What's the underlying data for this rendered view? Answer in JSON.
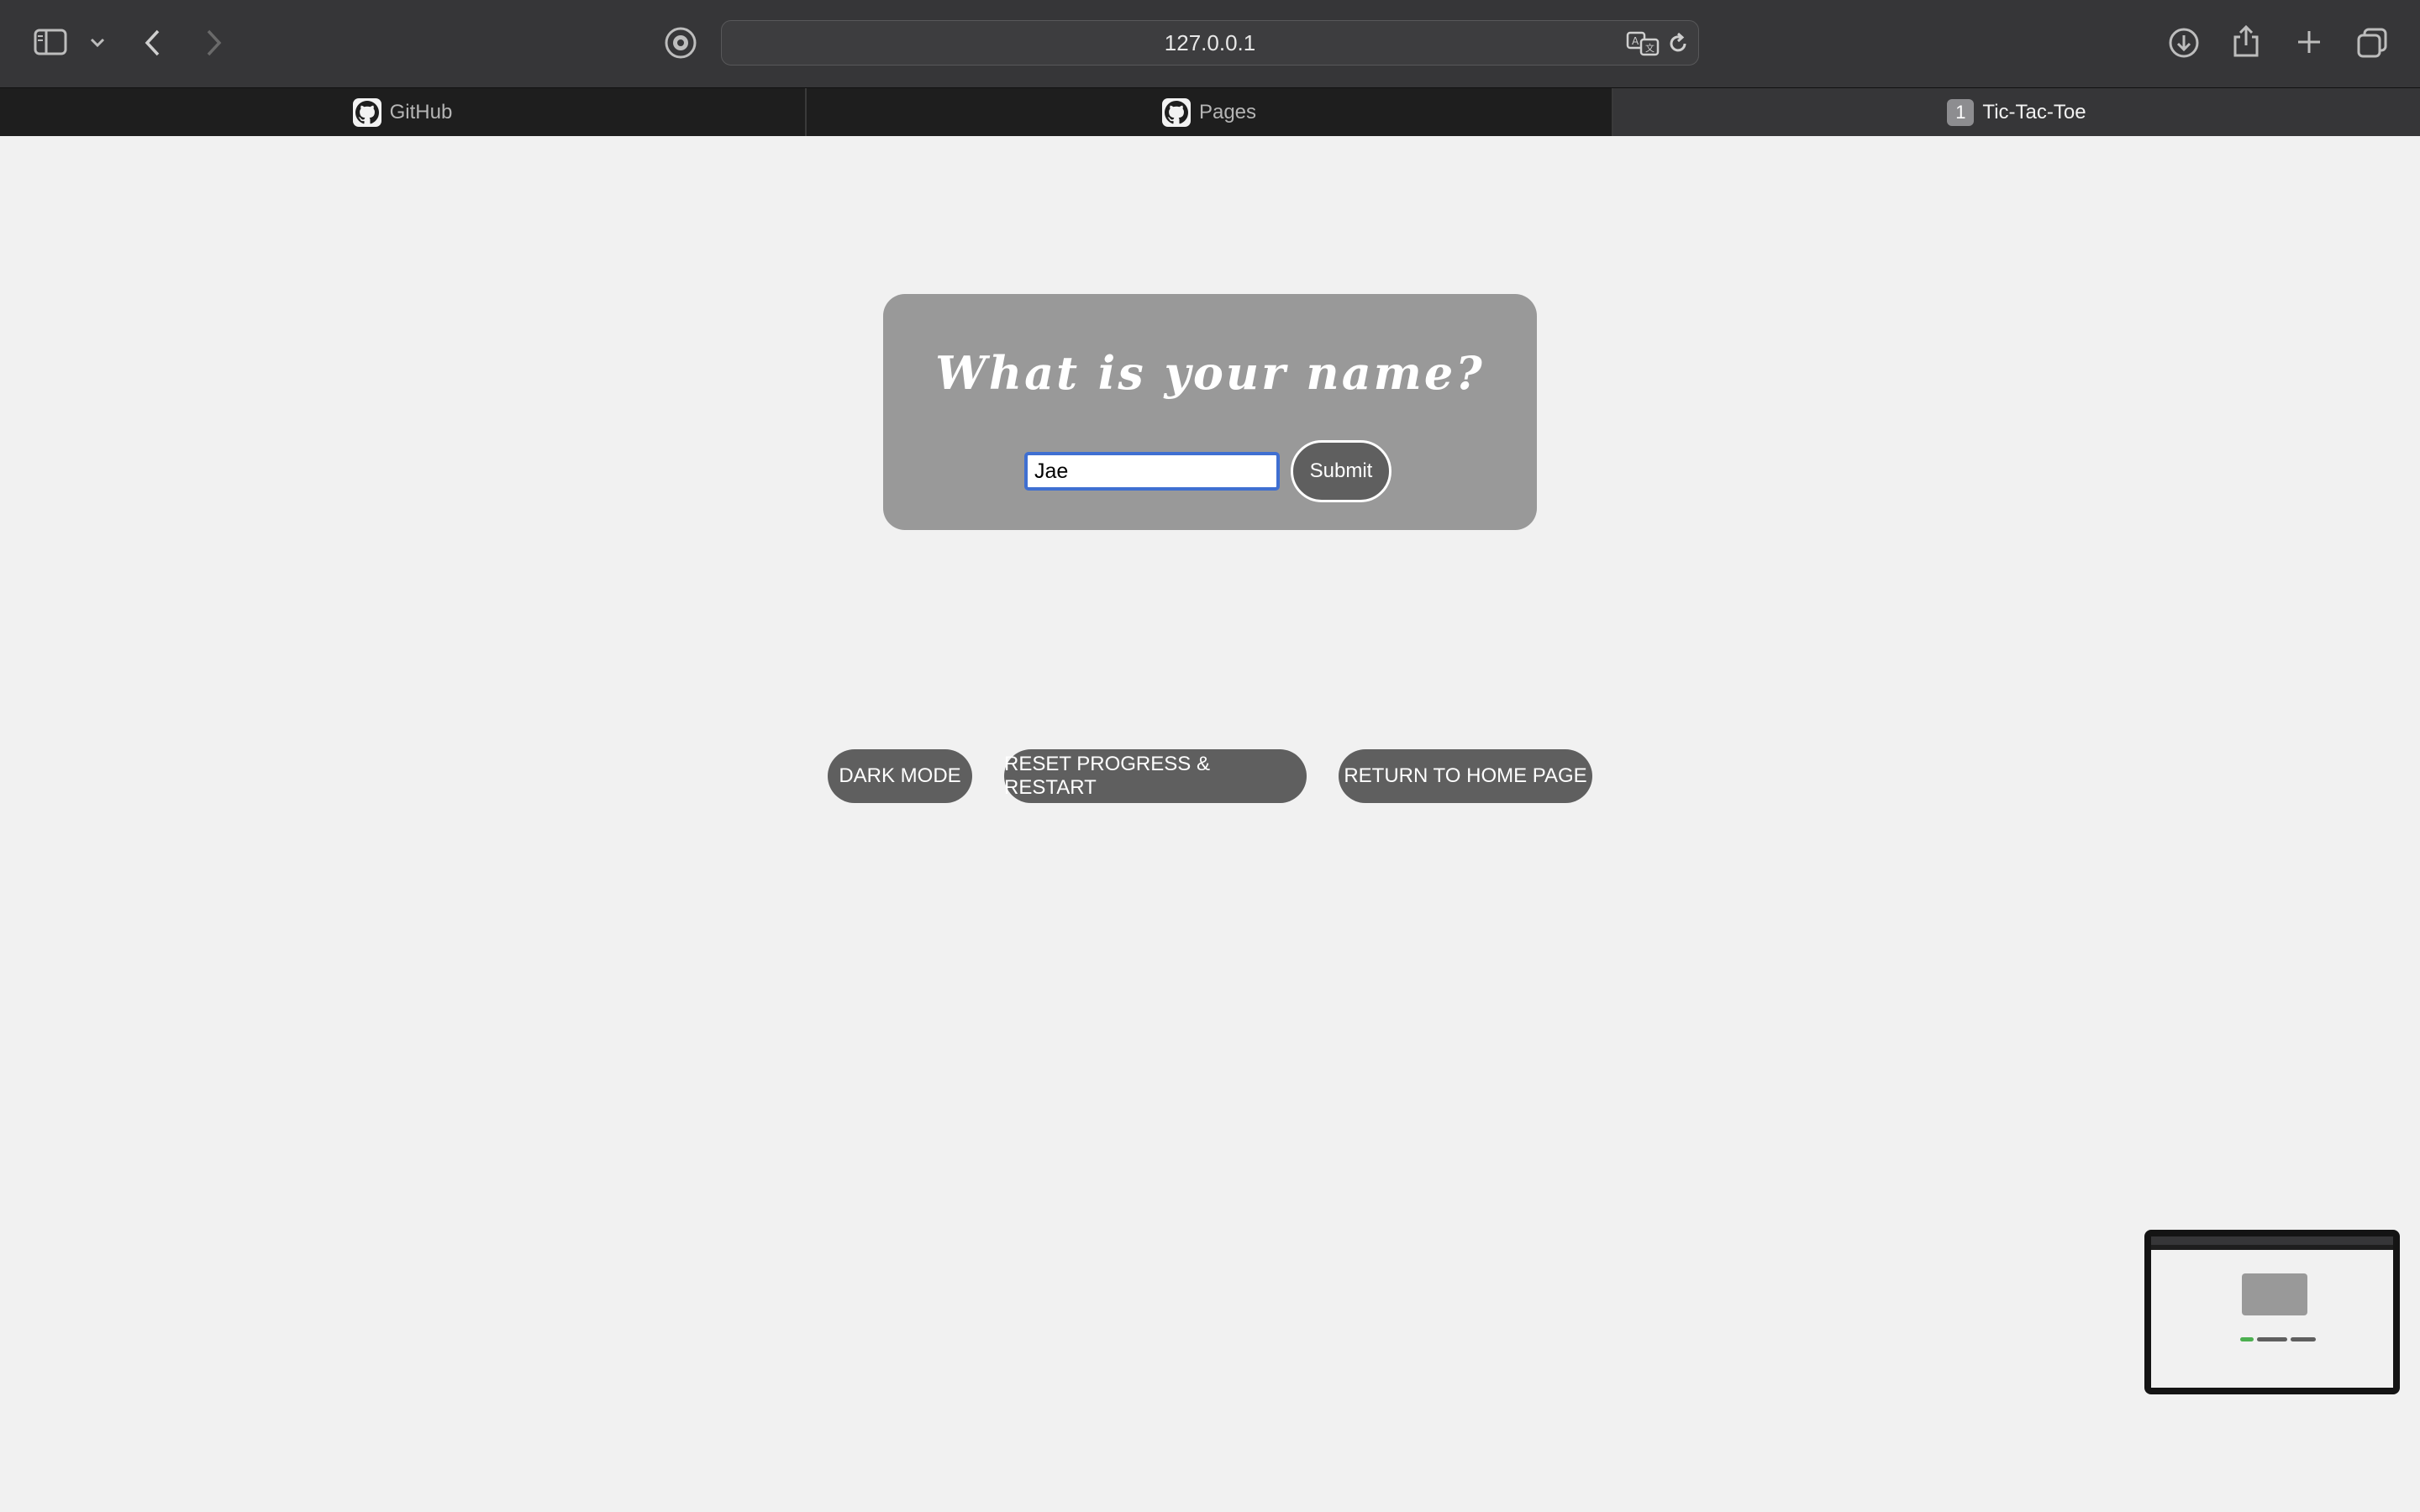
{
  "browser": {
    "url": "127.0.0.1",
    "tabs": [
      {
        "label": "GitHub",
        "favicon": "github-icon",
        "active": false
      },
      {
        "label": "Pages",
        "favicon": "github-icon",
        "active": false
      },
      {
        "label": "Tic-Tac-Toe",
        "favicon": "1",
        "active": true
      }
    ]
  },
  "prompt": {
    "heading": "What is your name?",
    "name_value": "Jae",
    "submit_label": "Submit"
  },
  "controls": {
    "dark_mode": "DARK MODE",
    "reset": "RESET PROGRESS & RESTART",
    "home": "RETURN TO HOME PAGE"
  },
  "colors": {
    "page_bg": "#f1f1f1",
    "card_bg": "#999999",
    "button_bg": "#5f5f5f",
    "toolbar_bg": "#363638",
    "input_focus": "#3f6fd1"
  }
}
